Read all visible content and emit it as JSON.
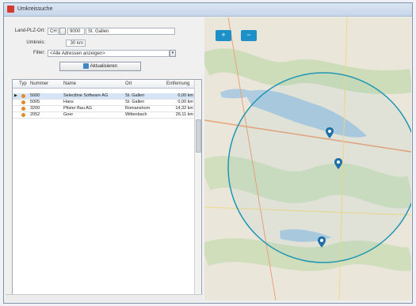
{
  "window": {
    "title": "Umkreissuche"
  },
  "form": {
    "land_plz_ort_label": "Land-PLZ-Ort:",
    "country": "CH",
    "plz": "9000",
    "ort": "St. Gallen",
    "umkreis_label": "Umkreis:",
    "umkreis_value": "30 km",
    "filter_label": "Filter:",
    "filter_value": "<Alle Adressen anzeigen>",
    "update_button": "Aktualisieren"
  },
  "table": {
    "headers": [
      "Typ",
      "Nummer",
      "Name",
      "Ort",
      "Entfernung"
    ],
    "rows": [
      {
        "nummer": "5000",
        "name": "Selectline Software AG",
        "ort": "St. Gallen",
        "entfernung": "0,00 km",
        "selected": true
      },
      {
        "nummer": "5005",
        "name": "Hans",
        "ort": "St. Gallen",
        "entfernung": "0,00 km",
        "selected": false
      },
      {
        "nummer": "3200",
        "name": "Pfister Bau AG",
        "ort": "Romanshorn",
        "entfernung": "14,32 km",
        "selected": false
      },
      {
        "nummer": "2052",
        "name": "Goer",
        "ort": "Wittenbach",
        "entfernung": "26,11 km",
        "selected": false
      }
    ]
  },
  "map": {
    "zoom_in": "+",
    "zoom_out": "−",
    "circle_color": "#1e96b4",
    "marker_color": "#1f6fa8"
  }
}
